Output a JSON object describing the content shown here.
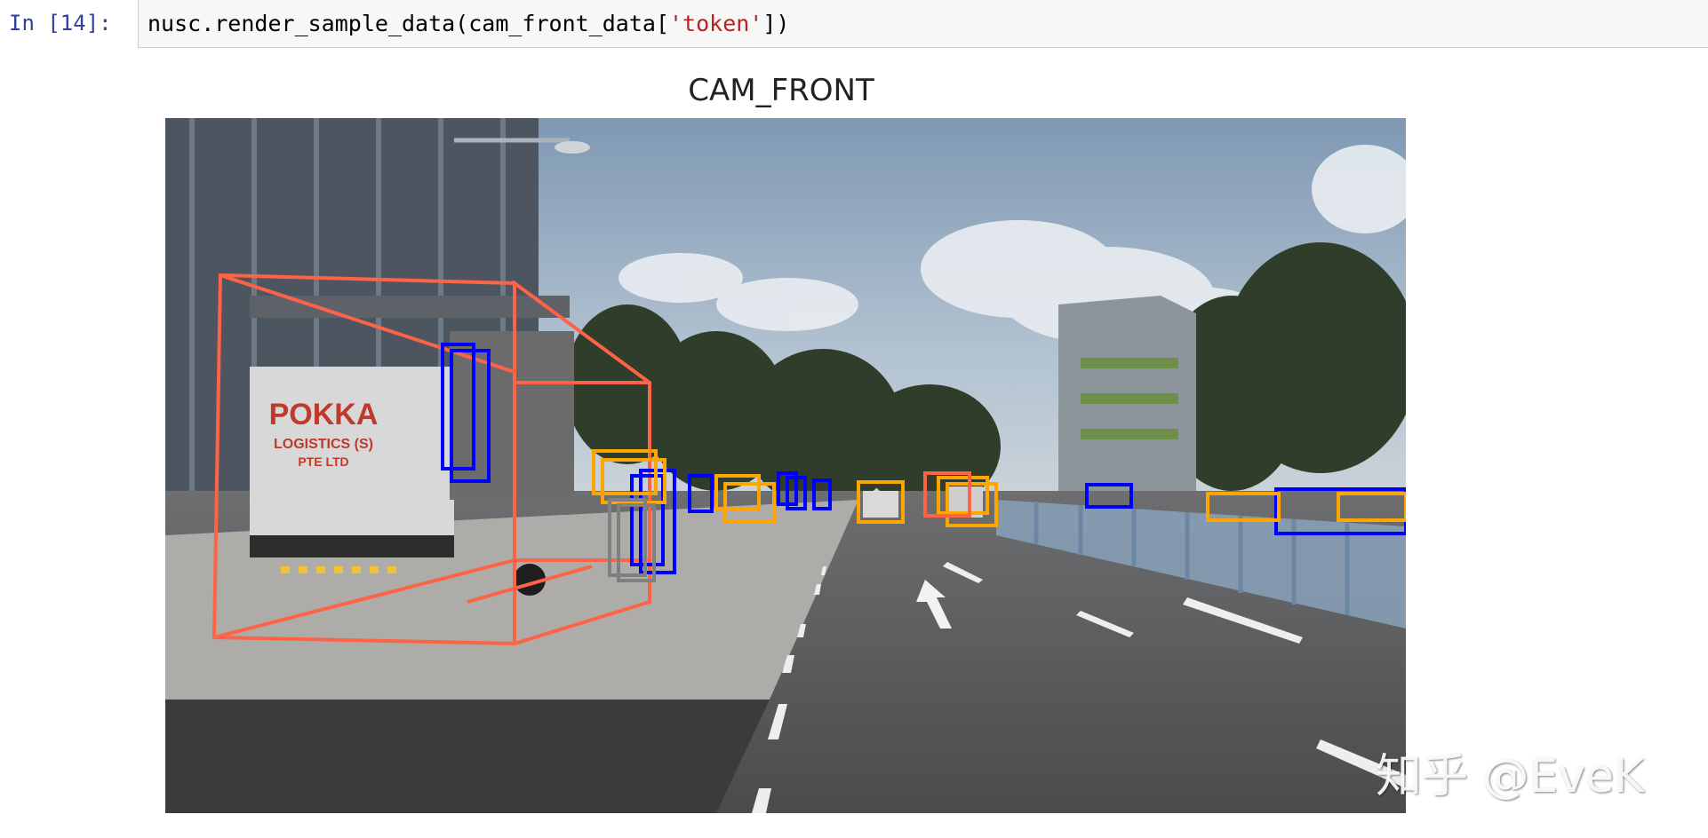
{
  "cell": {
    "prompt": "In [14]:",
    "code_prefix": "nusc.render_sample_data(cam_front_data[",
    "code_string": "'token'",
    "code_suffix": "])"
  },
  "figure": {
    "title": "CAM_FRONT"
  },
  "scene": {
    "truck_sign_line1": "POKKA",
    "truck_sign_line2": "LOGISTICS (S)",
    "truck_sign_line3": "PTE LTD",
    "box_colors": {
      "truck": "#ff6347",
      "pedestrian": "#0000ff",
      "car": "#ffa500",
      "barrier": "#7f9fbf",
      "misc": "#808080"
    }
  },
  "watermark": "知乎 @EveK"
}
